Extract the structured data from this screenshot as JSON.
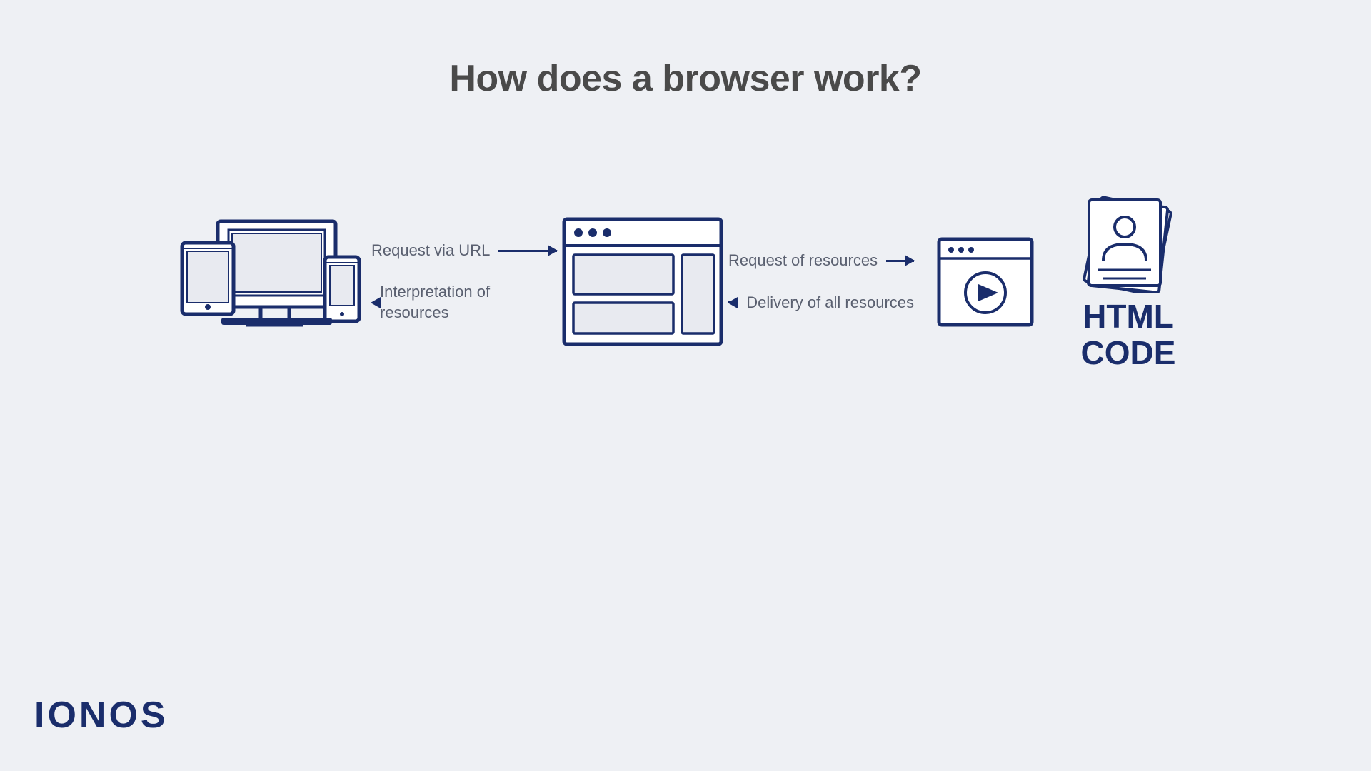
{
  "title": "How does a browser work?",
  "diagram": {
    "arrow1": {
      "right_label": "Request via URL",
      "left_label": "Interpretation of resources"
    },
    "arrow2": {
      "right_label": "Request of resources",
      "left_label": "Delivery of all resources"
    },
    "html_code_label_line1": "HTML",
    "html_code_label_line2": "CODE"
  },
  "logo": "IONOS",
  "colors": {
    "navy": "#1a2d6b",
    "gray_text": "#5a6070",
    "bg": "#eef0f4",
    "title": "#4a4a4a"
  }
}
